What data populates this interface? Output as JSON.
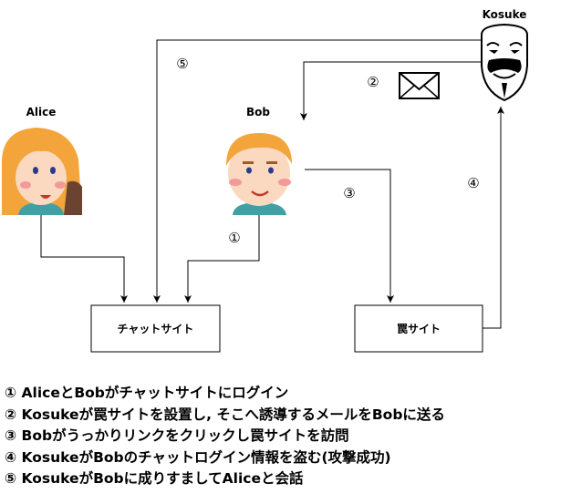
{
  "actors": {
    "alice": "Alice",
    "bob": "Bob",
    "kosuke": "Kosuke"
  },
  "icons": {
    "alice_avatar": "girl-face-icon",
    "bob_avatar": "boy-face-icon",
    "kosuke_avatar": "guy-fawkes-mask-icon",
    "mail": "envelope-icon"
  },
  "boxes": {
    "chat_site": "チャットサイト",
    "trap_site": "罠サイト"
  },
  "edge_labels": {
    "step1": "①",
    "step2": "②",
    "step3": "③",
    "step4": "④",
    "step5": "⑤"
  },
  "steps": [
    "① AliceとBobがチャットサイトにログイン",
    "② Kosukeが罠サイトを設置し, そこへ誘導するメールをBobに送る",
    "③ Bobがうっかりリンクをクリックし罠サイトを訪問",
    "④ KosukeがBobのチャットログイン情報を盗む(攻撃成功)",
    "⑤ KosukeがBobに成りすましてAliceと会話"
  ]
}
